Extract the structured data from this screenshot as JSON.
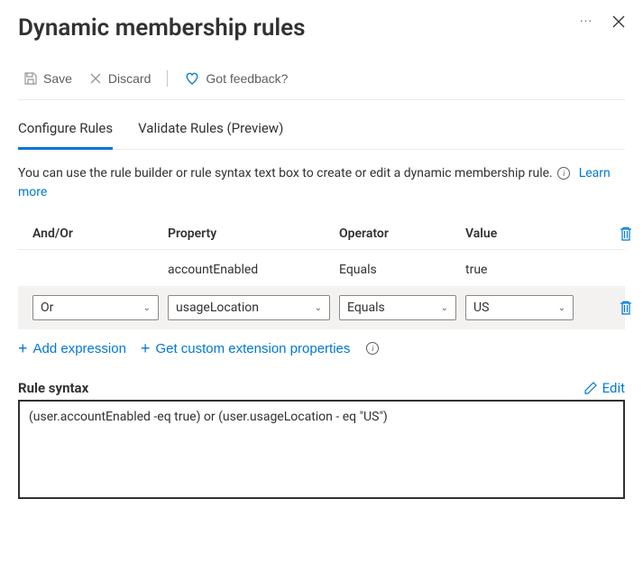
{
  "header": {
    "title": "Dynamic membership rules"
  },
  "toolbar": {
    "save_label": "Save",
    "discard_label": "Discard",
    "feedback_label": "Got feedback?"
  },
  "tabs": {
    "configure": "Configure Rules",
    "validate": "Validate Rules (Preview)"
  },
  "desc": {
    "text": "You can use the rule builder or rule syntax text box to create or edit a dynamic membership rule.",
    "learn_more": "Learn more"
  },
  "columns": {
    "andor": "And/Or",
    "property": "Property",
    "operator": "Operator",
    "value": "Value"
  },
  "rows": {
    "r1": {
      "property": "accountEnabled",
      "operator": "Equals",
      "value": "true"
    },
    "r2": {
      "andor": "Or",
      "property": "usageLocation",
      "operator": "Equals",
      "value": "US"
    }
  },
  "actions": {
    "add_expression": "Add expression",
    "get_custom": "Get custom extension properties"
  },
  "syntax": {
    "label": "Rule syntax",
    "edit": "Edit",
    "text": "(user.accountEnabled -eq true) or (user.usageLocation - eq \"US\")"
  }
}
